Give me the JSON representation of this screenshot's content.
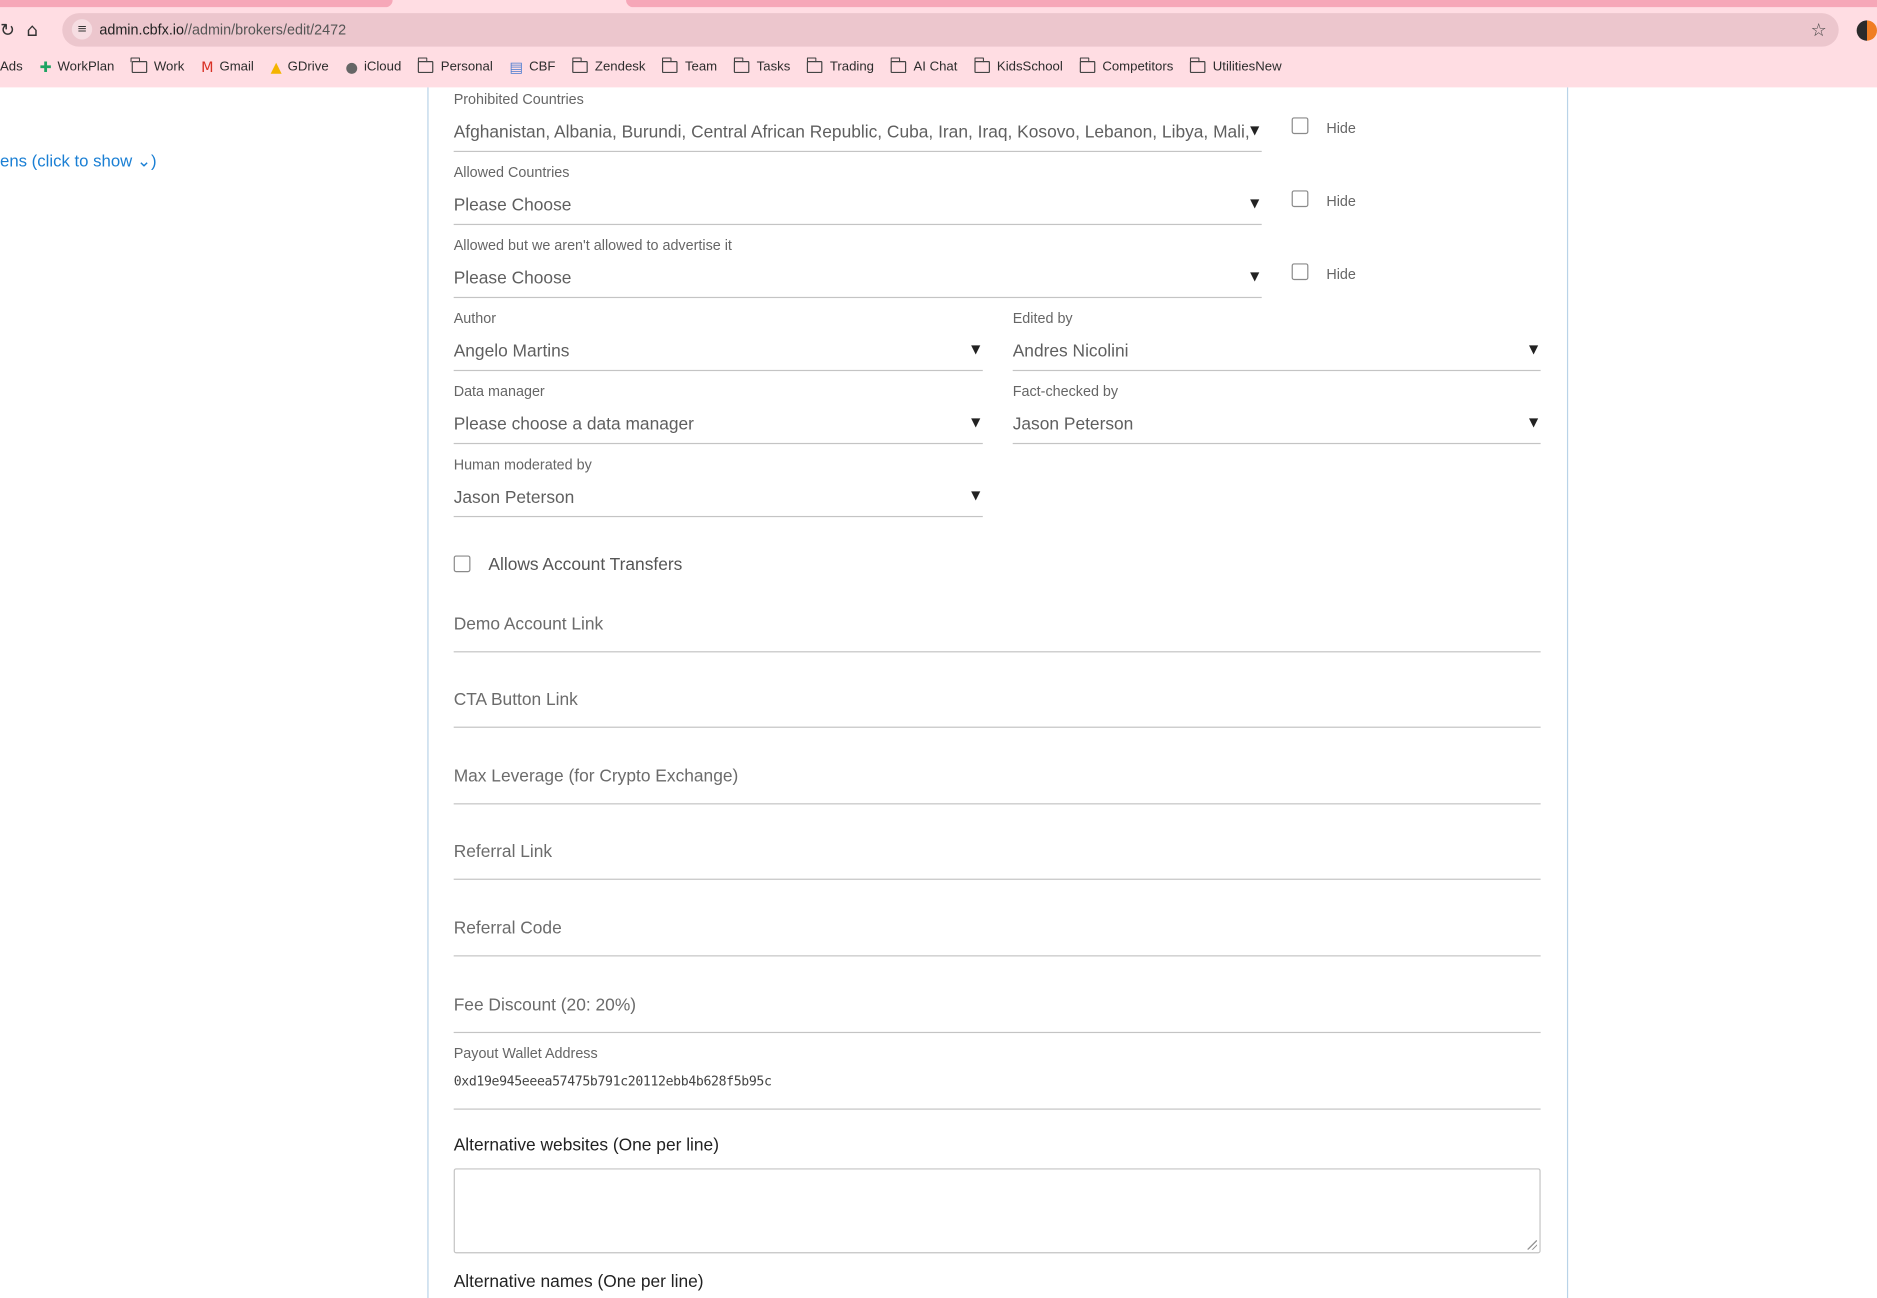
{
  "browser": {
    "url_host": "admin.cbfx.io",
    "url_path": "//admin/brokers/edit/2472",
    "bookmarks": [
      {
        "label": "Ads",
        "icon": "none"
      },
      {
        "label": "WorkPlan",
        "icon": "sheets-icon"
      },
      {
        "label": "Work",
        "icon": "folder-icon"
      },
      {
        "label": "Gmail",
        "icon": "gmail-icon"
      },
      {
        "label": "GDrive",
        "icon": "gdrive-icon"
      },
      {
        "label": "iCloud",
        "icon": "apple-icon"
      },
      {
        "label": "Personal",
        "icon": "folder-icon"
      },
      {
        "label": "CBF",
        "icon": "doc-icon"
      },
      {
        "label": "Zendesk",
        "icon": "folder-icon"
      },
      {
        "label": "Team",
        "icon": "folder-icon"
      },
      {
        "label": "Tasks",
        "icon": "folder-icon"
      },
      {
        "label": "Trading",
        "icon": "folder-icon"
      },
      {
        "label": "AI Chat",
        "icon": "folder-icon"
      },
      {
        "label": "KidsSchool",
        "icon": "folder-icon"
      },
      {
        "label": "Competitors",
        "icon": "folder-icon"
      },
      {
        "label": "UtilitiesNew",
        "icon": "folder-icon"
      }
    ]
  },
  "sidebar": {
    "toggle_link": "ens (click to show ⌄)"
  },
  "form": {
    "prohibited": {
      "label": "Prohibited Countries",
      "value": "Afghanistan, Albania, Burundi, Central African Republic, Cuba, Iran, Iraq, Kosovo, Lebanon, Libya, Mali, Myanmar, North Korea",
      "hide_label": "Hide"
    },
    "allowed": {
      "label": "Allowed Countries",
      "value": "Please Choose",
      "hide_label": "Hide"
    },
    "allowed_no_ad": {
      "label": "Allowed but we aren't allowed to advertise it",
      "value": "Please Choose",
      "hide_label": "Hide"
    },
    "author": {
      "label": "Author",
      "value": "Angelo Martins"
    },
    "edited_by": {
      "label": "Edited by",
      "value": "Andres Nicolini"
    },
    "data_manager": {
      "label": "Data manager",
      "value": "Please choose a data manager"
    },
    "fact_checked": {
      "label": "Fact-checked by",
      "value": "Jason Peterson"
    },
    "human_moderated": {
      "label": "Human moderated by",
      "value": "Jason Peterson"
    },
    "account_transfers_label": "Allows Account Transfers",
    "demo_link": "Demo Account Link",
    "cta_link": "CTA Button Link",
    "max_leverage": "Max Leverage (for Crypto Exchange)",
    "referral_link": "Referral Link",
    "referral_code": "Referral Code",
    "fee_discount": "Fee Discount (20: 20%)",
    "wallet": {
      "label": "Payout Wallet Address",
      "value": "0xd19e945eeea57475b791c20112ebb4b628f5b95c"
    },
    "alt_websites": "Alternative websites (One per line)",
    "alt_names": "Alternative names (One per line)",
    "arrow": "▼"
  }
}
